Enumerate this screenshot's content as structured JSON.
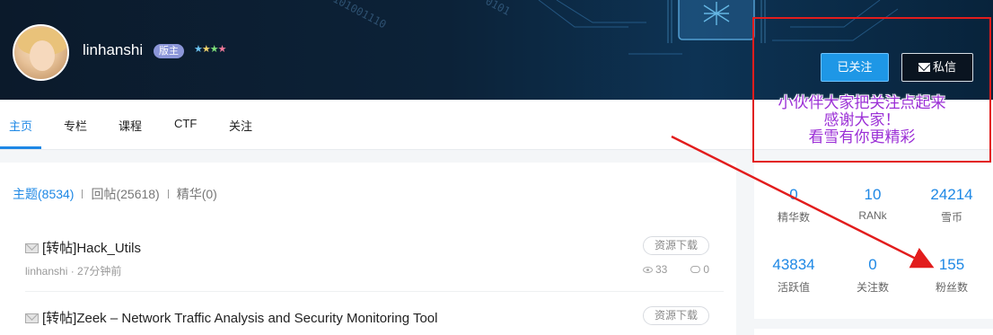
{
  "profile": {
    "username": "linhanshi",
    "role_badge": "版主",
    "stars": [
      "★",
      "★",
      "★",
      "★"
    ]
  },
  "actions": {
    "follow_label": "已关注",
    "message_label": "私信"
  },
  "tabs": [
    {
      "label": "主页"
    },
    {
      "label": "专栏"
    },
    {
      "label": "课程"
    },
    {
      "label": "CTF"
    },
    {
      "label": "关注"
    }
  ],
  "filters": {
    "topics": "主题(8534)",
    "replies": "回帖(25618)",
    "essence": "精华(0)"
  },
  "posts": [
    {
      "title": "[转帖]Hack_Utils",
      "tag": "资源下载",
      "author": "linhanshi",
      "time": "· 27分钟前",
      "views": "33",
      "comments": "0"
    },
    {
      "title": "[转帖]Zeek – Network Traffic Analysis and Security Monitoring Tool",
      "tag": "资源下载"
    }
  ],
  "stats": [
    {
      "value": "0",
      "label": "精华数"
    },
    {
      "value": "10",
      "label": "RANk"
    },
    {
      "value": "24214",
      "label": "雪币"
    },
    {
      "value": "43834",
      "label": "活跃值"
    },
    {
      "value": "0",
      "label": "关注数"
    },
    {
      "value": "155",
      "label": "粉丝数"
    }
  ],
  "annotation": {
    "lines": [
      "小伙伴大家把关注点起来",
      "感谢大家！",
      "看雪有你更精彩"
    ]
  },
  "banner_binary": [
    "101001110",
    "0101"
  ],
  "colors": {
    "accent": "#1e88e5",
    "annotation_red": "#e21d1d",
    "annotation_text": "#9b2fd6"
  }
}
